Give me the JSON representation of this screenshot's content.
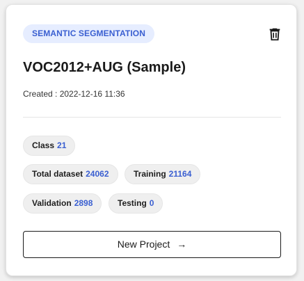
{
  "project_card": {
    "type_tag": "SEMANTIC SEGMENTATION",
    "title": "VOC2012+AUG (Sample)",
    "created": "Created : 2022-12-16 11:36",
    "delete_icon": "trash-icon",
    "stats": {
      "class": {
        "label": "Class",
        "value": "21"
      },
      "total_dataset": {
        "label": "Total dataset",
        "value": "24062"
      },
      "training": {
        "label": "Training",
        "value": "21164"
      },
      "validation": {
        "label": "Validation",
        "value": "2898"
      },
      "testing": {
        "label": "Testing",
        "value": "0"
      }
    },
    "new_project_button": {
      "label": "New Project",
      "icon": "arrow-right-icon",
      "arrow": "→"
    }
  },
  "colors": {
    "accent": "#3a5fd1",
    "tag_background": "#e6edff",
    "chip_background": "#efefef",
    "page_background": "#f1f1f1"
  }
}
